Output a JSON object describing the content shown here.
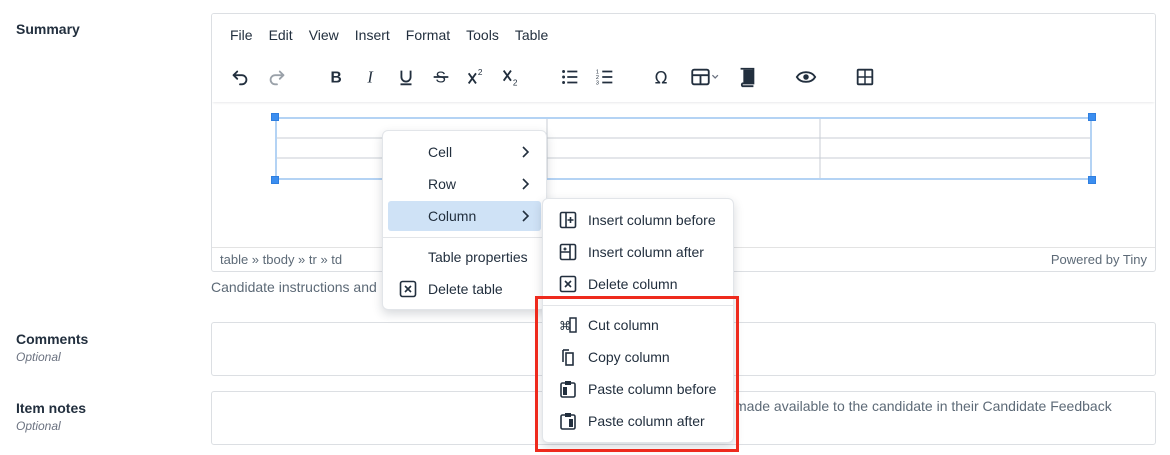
{
  "summary": {
    "label": "Summary"
  },
  "editor": {
    "menubar": [
      "File",
      "Edit",
      "View",
      "Insert",
      "Format",
      "Tools",
      "Table"
    ],
    "statusbar": {
      "path": "table » tbody » tr » td",
      "powered": "Powered by Tiny"
    }
  },
  "hint": "Candidate instructions and",
  "comments": {
    "label": "Comments",
    "sub": "Optional"
  },
  "item_notes": {
    "label": "Item notes",
    "sub": "Optional",
    "hint_tail": "made available to the candidate in their Candidate Feedback"
  },
  "table_menu": {
    "items": [
      {
        "label": "Cell"
      },
      {
        "label": "Row"
      },
      {
        "label": "Column"
      },
      {
        "label": "Table properties"
      },
      {
        "label": "Delete table"
      }
    ]
  },
  "column_menu": {
    "items": [
      {
        "label": "Insert column before"
      },
      {
        "label": "Insert column after"
      },
      {
        "label": "Delete column"
      },
      {
        "label": "Cut column"
      },
      {
        "label": "Copy column"
      },
      {
        "label": "Paste column before"
      },
      {
        "label": "Paste column after"
      }
    ]
  },
  "colors": {
    "highlight_box": "#ee2a1d",
    "active_item": "#cfe2f6",
    "table_selection": "#b4d3f4"
  }
}
